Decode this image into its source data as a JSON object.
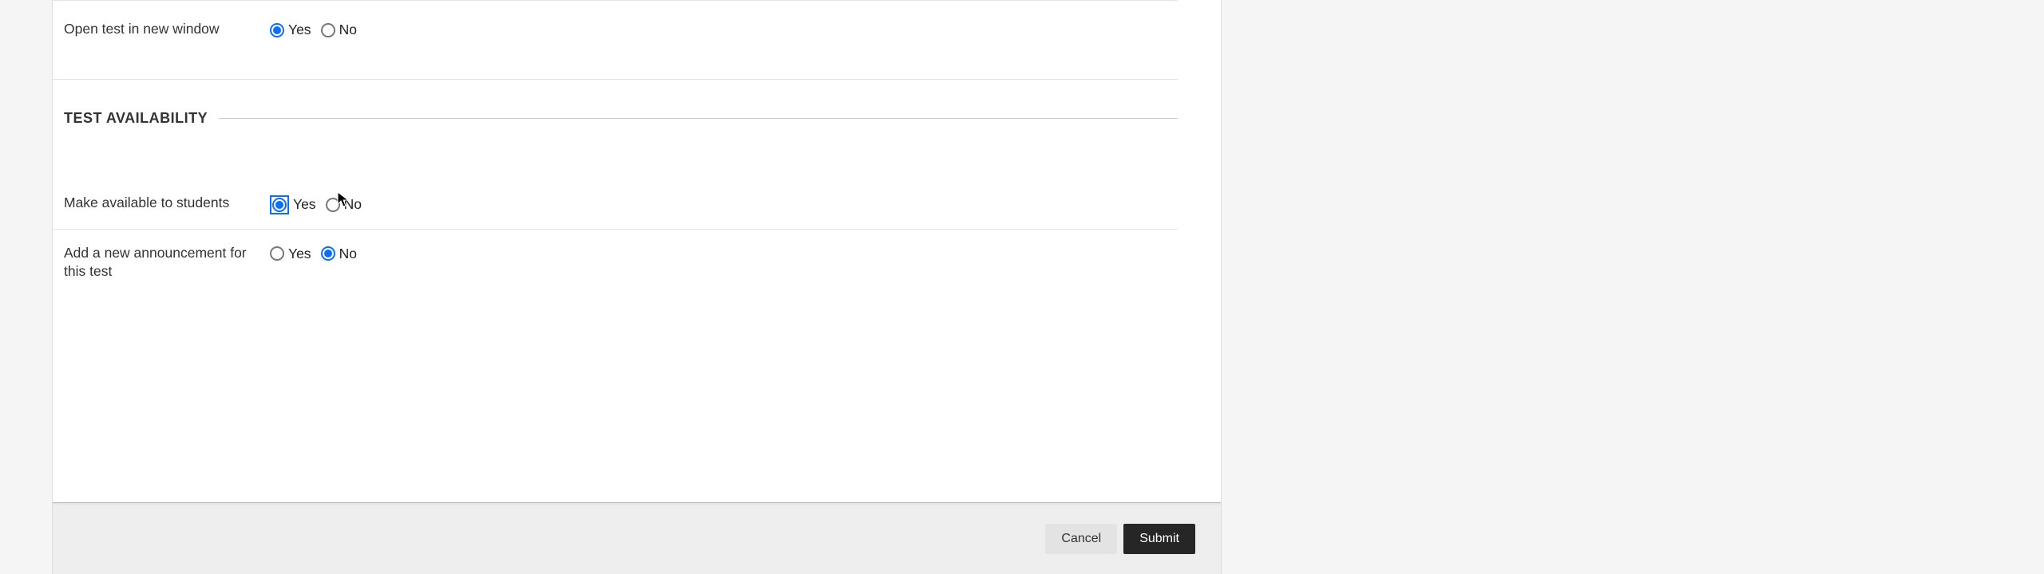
{
  "options": {
    "open_new_window": {
      "label": "Open test in new window",
      "yes": "Yes",
      "no": "No",
      "selected": "yes"
    }
  },
  "section": {
    "title": "TEST AVAILABILITY"
  },
  "availability": {
    "make_available": {
      "label": "Make available to students",
      "yes": "Yes",
      "no": "No",
      "selected": "yes"
    },
    "add_announcement": {
      "label": "Add a new announcement for this test",
      "yes": "Yes",
      "no": "No",
      "selected": "no"
    }
  },
  "footer": {
    "cancel": "Cancel",
    "submit": "Submit"
  }
}
